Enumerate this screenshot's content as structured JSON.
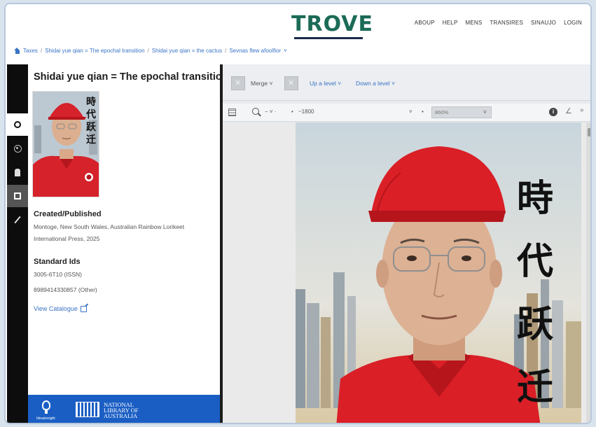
{
  "header": {
    "logo": "TROVE",
    "nav": [
      "ABOUP",
      "HELP",
      "MENS",
      "TRANSIRES",
      "SINAUJO",
      "LOGIN"
    ]
  },
  "breadcrumb": [
    "Taxes",
    "Shidai yue qian = The epochal transition",
    "Shidai yue qian = the cactus",
    "Sevnas flew afoolfior"
  ],
  "rail": {
    "icons": [
      "record-icon",
      "disc-icon",
      "building-icon",
      "document-icon",
      "pen-icon"
    ]
  },
  "details": {
    "title": "Shidai yue qian = The epochal transition",
    "created_heading": "Created/Published",
    "created_text": "Montoge, New South Wales, Australian Rainbow Lorikeet International Press, 2025",
    "ids_heading": "Standard Ids",
    "id_1": "3005-6T10 (ISSN)",
    "id_2": "8989414330857 (Other)",
    "catalogue_link": "View Catalogue",
    "cover_text": [
      "時",
      "代",
      "跃",
      "迁"
    ]
  },
  "footer": {
    "left_label": "Ideasinsight",
    "nla_text": "NATIONAL LIBRARY OF AUSTRALIA"
  },
  "viewer": {
    "toolbar": {
      "merge": "Merge",
      "up_level": "Up a level",
      "down_level": "Down a level"
    },
    "secondary": {
      "zoom_glyph": "− ˅ ·",
      "page": "1800",
      "zoom_percent": "860%"
    },
    "image_text": [
      "時",
      "代",
      "跃",
      "迁"
    ]
  },
  "colors": {
    "brand_green": "#1b6b57",
    "link_blue": "#3a74c6",
    "footer_blue": "#1a5ec4"
  }
}
